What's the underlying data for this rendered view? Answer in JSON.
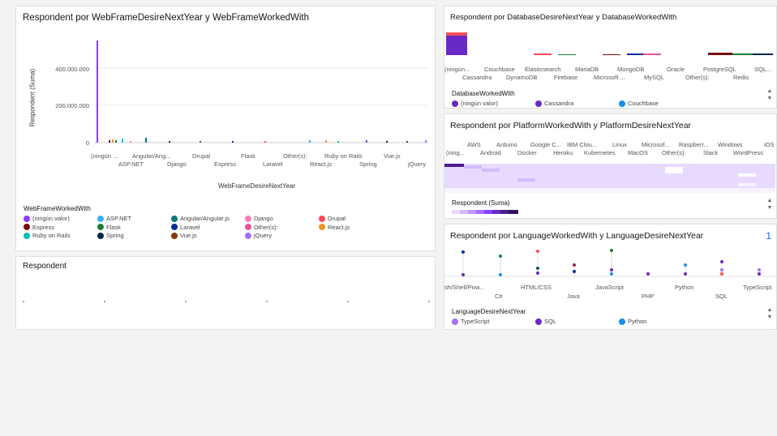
{
  "card1": {
    "title": "Respondent por WebFrameDesireNextYear y WebFrameWorkedWith",
    "y_axis_title": "Respondent (Suma)",
    "x_axis_title": "WebFrameDesireNextYear",
    "y_ticks": [
      "400.000.000",
      "200.000.000",
      "0"
    ],
    "x_ticks_row1": [
      "(ningún ...",
      "Angular/Ang...",
      "Drupal",
      "Flask",
      "Other(s):",
      "Ruby on Rails",
      "Vue.js"
    ],
    "x_ticks_row2": [
      "ASP.NET",
      "Django",
      "Express",
      "Laravel",
      "React.js",
      "Spring",
      "jQuery"
    ],
    "legend_title": "WebFrameWorkedWith",
    "legend": [
      {
        "label": "(ningún valor)",
        "color": "#8a3ffc"
      },
      {
        "label": "ASP.NET",
        "color": "#33b1ff"
      },
      {
        "label": "Angular/Angular.js",
        "color": "#007d79"
      },
      {
        "label": "Django",
        "color": "#ff7eb6"
      },
      {
        "label": "Drupal",
        "color": "#fa4d56"
      },
      {
        "label": "Express",
        "color": "#750e13"
      },
      {
        "label": "Flask",
        "color": "#198038"
      },
      {
        "label": "Laravel",
        "color": "#002d9c"
      },
      {
        "label": "Other(s):",
        "color": "#ee5396"
      },
      {
        "label": "React.js",
        "color": "#f1932b"
      },
      {
        "label": "Ruby on Rails",
        "color": "#08bdba"
      },
      {
        "label": "Spring",
        "color": "#012749"
      },
      {
        "label": "Vue.js",
        "color": "#8a3800"
      },
      {
        "label": "jQuery",
        "color": "#a56eff"
      }
    ]
  },
  "card2": {
    "title": "Respondent"
  },
  "card3": {
    "title": "Respondent por DatabaseDesireNextYear y DatabaseWorkedWith",
    "x_ticks_row1": [
      "(ningún...",
      "Couchbase",
      "Elasticsearch",
      "MariaDB",
      "MongoDB",
      "Oracle",
      "PostgreSQL",
      "SQL..."
    ],
    "x_ticks_row2": [
      "Cassandra",
      "DynamoDB",
      "Firebase",
      "Microsoft ...",
      "MySQL",
      "Other(s):",
      "Redis"
    ],
    "legend_title": "DatabaseWorkedWith",
    "legend": [
      {
        "label": "(ningún valor)",
        "color": "#6929c4"
      },
      {
        "label": "Cassandra",
        "color": "#6929c4"
      },
      {
        "label": "Couchbase",
        "color": "#1192e8"
      }
    ]
  },
  "card4": {
    "title": "Respondent por PlatformWorkedWith y PlatformDesireNextYear",
    "x_ticks_row1": [
      "AWS",
      "Arduino",
      "Google C...",
      "IBM Clou...",
      "Linux",
      "Microsof...",
      "Raspberr...",
      "Windows",
      "iOS"
    ],
    "x_ticks_row2": [
      "(ning...",
      "Android",
      "Docker",
      "Heroku",
      "Kubernetes",
      "MacOS",
      "Other(s):",
      "Slack",
      "WordPress"
    ],
    "legend_title": "Respondent (Suma)"
  },
  "card5": {
    "title": "Respondent por LanguageWorkedWith y LanguageDesireNextYear",
    "badge": "1",
    "x_ticks_row1": [
      "sh/Shell/Pow...",
      "HTML/CSS",
      "JavaScript",
      "Python",
      "TypeScript"
    ],
    "x_ticks_row2": [
      "C#",
      "Java",
      "PHP",
      "SQL"
    ],
    "legend_title": "LanguageDesireNextYear",
    "legend": [
      {
        "label": "TypeScript",
        "color": "#a56eff"
      },
      {
        "label": "SQL",
        "color": "#6929c4"
      },
      {
        "label": "Python",
        "color": "#1192e8"
      }
    ]
  },
  "icons": {
    "scroll_up": "▲",
    "scroll_down": "▼"
  }
}
